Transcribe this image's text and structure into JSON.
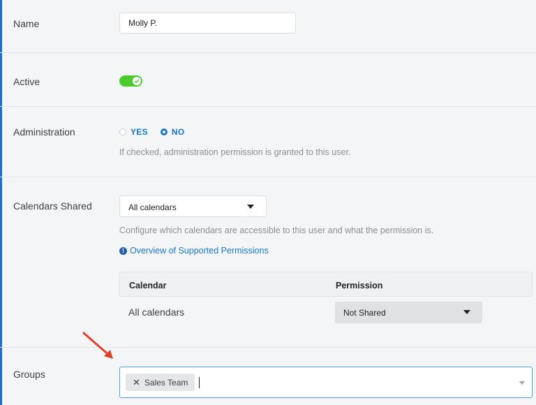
{
  "name_field": {
    "label": "Name",
    "value": "Molly P."
  },
  "active_field": {
    "label": "Active",
    "state": "on",
    "color": "#4ccb2f"
  },
  "administration_field": {
    "label": "Administration",
    "options": [
      "YES",
      "NO"
    ],
    "selected": "NO",
    "help": "If checked, administration permission is granted to this user."
  },
  "calendars_field": {
    "label": "Calendars Shared",
    "selected": "All calendars",
    "help": "Configure which calendars are accessible to this user and what the permission is.",
    "link": "Overview of Supported Permissions",
    "table": {
      "headers": [
        "Calendar",
        "Permission"
      ],
      "rows": [
        {
          "calendar": "All calendars",
          "permission": "Not Shared"
        }
      ]
    }
  },
  "groups_field": {
    "label": "Groups",
    "tags": [
      "Sales Team"
    ],
    "accent_color": "#4aa3df"
  },
  "colors": {
    "link": "#1877c9",
    "annotation_arrow": "#e0402a"
  },
  "icons": {
    "toggle": "check-icon",
    "info": "info-icon",
    "remove": "close-icon",
    "annotation": "arrow-icon"
  }
}
